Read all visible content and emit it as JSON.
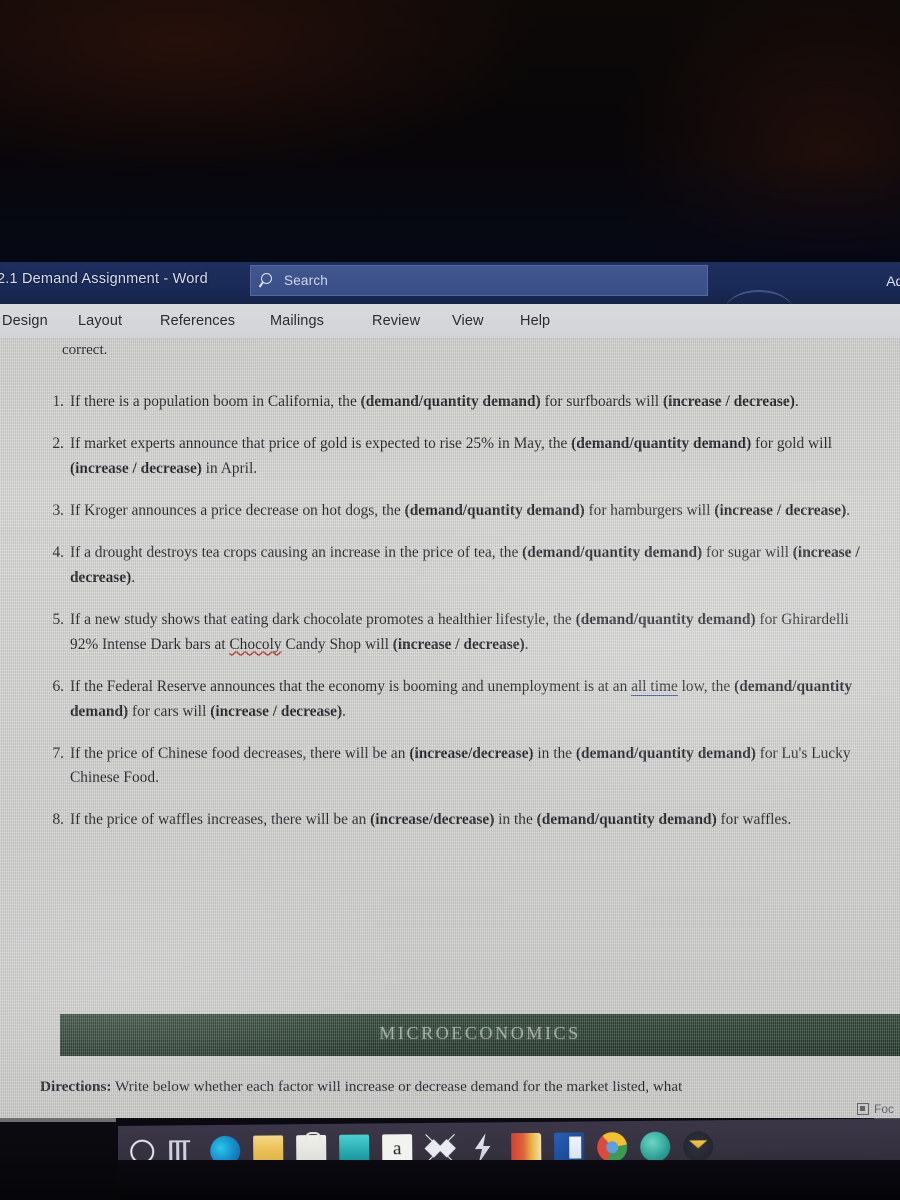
{
  "window": {
    "title": "2.1 Demand Assignment  -  Word",
    "account_name": "Adr",
    "search_placeholder": "Search",
    "search_icon": "search-icon"
  },
  "ribbon": {
    "tabs": [
      {
        "label": "Design"
      },
      {
        "label": "Layout"
      },
      {
        "label": "References"
      },
      {
        "label": "Mailings"
      },
      {
        "label": "Review"
      },
      {
        "label": "View"
      },
      {
        "label": "Help"
      }
    ]
  },
  "document": {
    "intro_fragment": "correct.",
    "questions": [
      {
        "number": "1.",
        "parts": [
          {
            "t": "If there is a population boom in California, the ",
            "b": false
          },
          {
            "t": "(demand/quantity demand)",
            "b": true
          },
          {
            "t": " for surfboards will ",
            "b": false
          },
          {
            "t": "(increase / decrease)",
            "b": true
          },
          {
            "t": ".",
            "b": false
          }
        ]
      },
      {
        "number": "2.",
        "parts": [
          {
            "t": "If market experts announce that price of gold is expected to rise 25% in May, the ",
            "b": false
          },
          {
            "t": "(demand/quantity demand)",
            "b": true
          },
          {
            "t": " for gold will ",
            "b": false
          },
          {
            "t": "(increase / decrease)",
            "b": true
          },
          {
            "t": " in April.",
            "b": false
          }
        ]
      },
      {
        "number": "3.",
        "parts": [
          {
            "t": "If Kroger announces a price decrease on hot dogs, the ",
            "b": false
          },
          {
            "t": "(demand/quantity demand)",
            "b": true
          },
          {
            "t": " for hamburgers will ",
            "b": false
          },
          {
            "t": "(increase / decrease)",
            "b": true
          },
          {
            "t": ".",
            "b": false
          }
        ]
      },
      {
        "number": "4.",
        "parts": [
          {
            "t": "If a drought destroys tea crops causing an increase in the price of tea, the ",
            "b": false
          },
          {
            "t": "(demand/quantity demand)",
            "b": true
          },
          {
            "t": " for sugar will ",
            "b": false
          },
          {
            "t": "(increase / decrease)",
            "b": true
          },
          {
            "t": ".",
            "b": false
          }
        ]
      },
      {
        "number": "5.",
        "parts": [
          {
            "t": "If a new study shows that eating dark chocolate promotes a healthier lifestyle, the ",
            "b": false
          },
          {
            "t": "(demand/quantity demand)",
            "b": true
          },
          {
            "t": " for Ghirardelli 92% Intense Dark bars at ",
            "b": false
          },
          {
            "t": "Chocoly",
            "b": false,
            "spell": true
          },
          {
            "t": " Candy Shop will ",
            "b": false
          },
          {
            "t": "(increase / decrease)",
            "b": true
          },
          {
            "t": ".",
            "b": false
          }
        ]
      },
      {
        "number": "6.",
        "parts": [
          {
            "t": "If the Federal Reserve announces that the economy is booming and unemployment is at an ",
            "b": false
          },
          {
            "t": "all time",
            "b": false,
            "grammar": true
          },
          {
            "t": " low, the ",
            "b": false
          },
          {
            "t": "(demand/quantity demand)",
            "b": true
          },
          {
            "t": " for cars will ",
            "b": false
          },
          {
            "t": "(increase / decrease)",
            "b": true
          },
          {
            "t": ".",
            "b": false
          }
        ]
      },
      {
        "number": "7.",
        "parts": [
          {
            "t": "If the price of Chinese food decreases, there will be an ",
            "b": false
          },
          {
            "t": "(increase/decrease)",
            "b": true
          },
          {
            "t": " in the ",
            "b": false
          },
          {
            "t": "(demand/quantity demand)",
            "b": true
          },
          {
            "t": " for Lu's Lucky Chinese Food.",
            "b": false
          }
        ]
      },
      {
        "number": "8.",
        "parts": [
          {
            "t": "If the price of waffles increases, there will be an ",
            "b": false
          },
          {
            "t": "(increase/decrease)",
            "b": true
          },
          {
            "t": " in the ",
            "b": false
          },
          {
            "t": "(demand/quantity demand)",
            "b": true
          },
          {
            "t": " for waffles.",
            "b": false
          }
        ]
      }
    ],
    "banner_heading": "MICROECONOMICS",
    "directions_label": "Directions:",
    "directions_text": " Write below whether each factor will increase or decrease demand for the market listed, what"
  },
  "status_bar": {
    "focus_label": "Foc",
    "focus_icon": "focus-mode-icon"
  },
  "taskbar": {
    "items": [
      {
        "icon": "cortana-circle-icon",
        "cls": "ico-cortana",
        "glyph": ""
      },
      {
        "icon": "task-view-icon",
        "cls": "ico-taskview",
        "glyph": ""
      },
      {
        "icon": "edge-browser-icon",
        "cls": "ico-edge",
        "glyph": ""
      },
      {
        "icon": "file-explorer-icon",
        "cls": "ico-explorer",
        "glyph": ""
      },
      {
        "icon": "microsoft-store-icon",
        "cls": "ico-store",
        "glyph": ""
      },
      {
        "icon": "teal-app-icon",
        "cls": "ico-teal",
        "glyph": ""
      },
      {
        "icon": "acrobat-reader-icon",
        "cls": "ico-acrobat",
        "glyph": "a"
      },
      {
        "icon": "dropbox-icon",
        "cls": "ico-dropbox",
        "glyph": ""
      },
      {
        "icon": "lightning-bolt-icon",
        "cls": "ico-bolt",
        "glyph": ""
      },
      {
        "icon": "book-app-icon",
        "cls": "ico-book",
        "glyph": ""
      },
      {
        "icon": "word-icon",
        "cls": "ico-word",
        "glyph": ""
      },
      {
        "icon": "chrome-browser-icon",
        "cls": "ico-chrome",
        "glyph": ""
      },
      {
        "icon": "mint-app-icon",
        "cls": "ico-mint",
        "glyph": ""
      },
      {
        "icon": "mail-app-icon",
        "cls": "ico-gmail",
        "glyph": ""
      }
    ]
  }
}
